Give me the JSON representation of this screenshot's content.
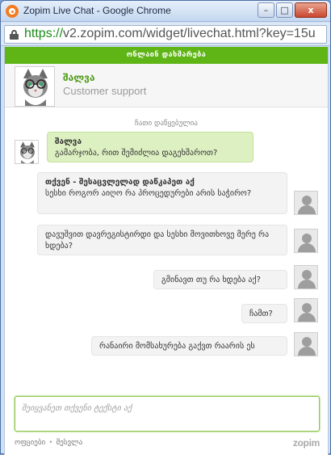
{
  "window": {
    "title": "Zopim Live Chat - Google Chrome",
    "url_scheme": "https://",
    "url_rest": "v2.zopim.com/widget/livechat.html?key=15u",
    "controls": {
      "minimize": "–",
      "maximize": "□",
      "close": "x"
    }
  },
  "colors": {
    "accent": "#5fb515",
    "agent_bubble": "#ddf0c2",
    "visitor_bubble": "#f3f3f3"
  },
  "status": "ონლაინ დახმარება",
  "agent": {
    "name": "შალვა",
    "role": "Customer support"
  },
  "chat": {
    "notice": "ჩათი დაწყებულია",
    "messages": [
      {
        "from": "agent",
        "name": "შალვა",
        "text": "გამარჯობა, რით შემიძლია დაგეხმაროთ?"
      },
      {
        "from": "visitor",
        "name": "თქვენ - შესაცვლელად დაწკაპეთ აქ",
        "text": "სესხი როგორ აიღო რა პროცედურები არის საჭირო?"
      },
      {
        "from": "visitor",
        "text": "დავუშვით დავრეგისტირდი და სესხი მოვითხოვე მერე რა ხდება?"
      },
      {
        "from": "visitor",
        "text": "გმინავთ თუ რა ხდება აქ?"
      },
      {
        "from": "visitor",
        "text": "ჩამთ?"
      },
      {
        "from": "visitor",
        "text": "რანაირი მომსახურება გაქვთ რაარის ეს"
      }
    ]
  },
  "composer": {
    "placeholder": "შეიყვანეთ თქვენი ტექსტი აქ"
  },
  "footer": {
    "offline": "ოფციები",
    "separator": "•",
    "login": "შესვლა",
    "brand": "zopim"
  }
}
